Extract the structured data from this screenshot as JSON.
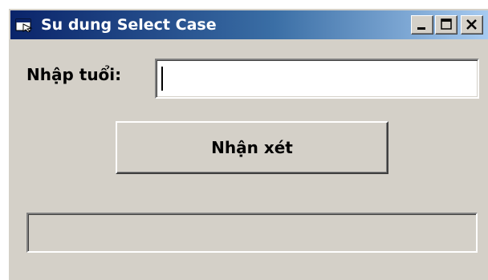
{
  "window": {
    "title": "Su dung Select Case",
    "icon": "vb-form-icon",
    "controls": [
      "minimize-icon",
      "maximize-icon",
      "close-icon"
    ]
  },
  "form": {
    "age_label": "Nhập tuổi:",
    "age_value": "",
    "comment_button_label": "Nhận xét",
    "result_text": ""
  },
  "colors": {
    "titlebar_start": "#0a246a",
    "titlebar_end": "#a6caf0",
    "face": "#d4d0c8"
  }
}
